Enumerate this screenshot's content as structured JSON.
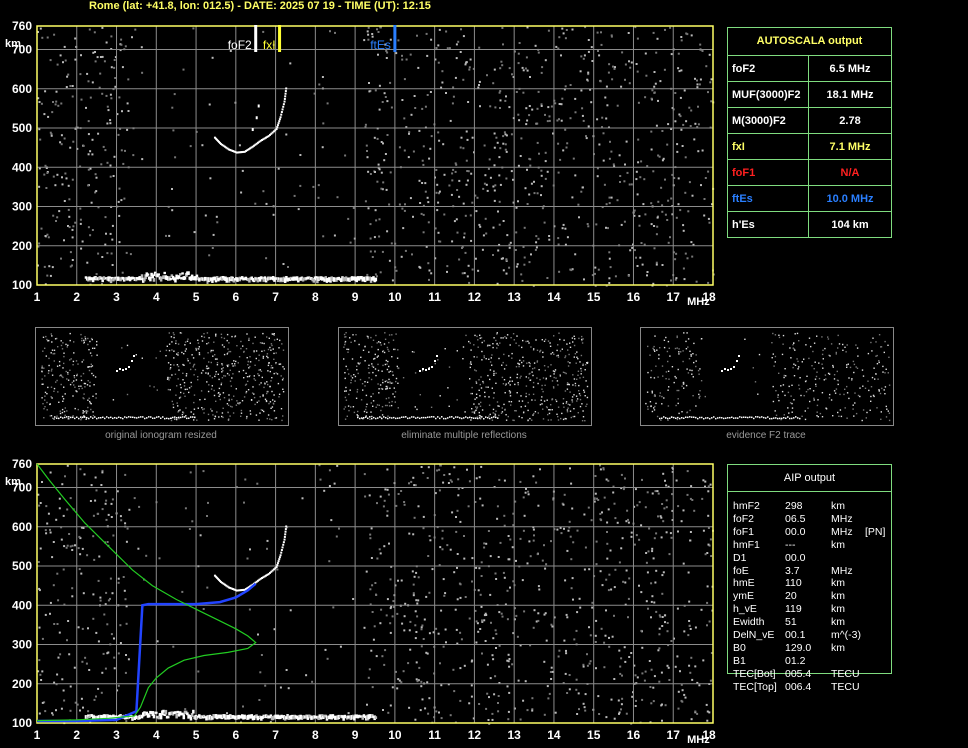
{
  "header": "Rome (lat: +41.8, lon: 012.5) - DATE: 2025 07 19 - TIME (UT): 12:15",
  "colors": {
    "grid": "#8c8c8c",
    "frame": "#ffff66",
    "panel_border": "#7fdc7f",
    "profile": "#22cc22",
    "trace_blue": "#2244ff",
    "foF2": "#ffffff",
    "fxI": "#ffff33",
    "ftEs": "#2a7fff",
    "label_red": "#ff2020",
    "label_yellow": "#ffff66",
    "label_blue": "#2a7fff"
  },
  "autoscala": {
    "title": "AUTOSCALA output",
    "rows": [
      {
        "label": "foF2",
        "value": "6.5 MHz",
        "color": "#ffffff"
      },
      {
        "label": "MUF(3000)F2",
        "value": "18.1 MHz",
        "color": "#ffffff"
      },
      {
        "label": "M(3000)F2",
        "value": "2.78",
        "color": "#ffffff"
      },
      {
        "label": "fxI",
        "value": "7.1 MHz",
        "color": "#ffff66"
      },
      {
        "label": "foF1",
        "value": "N/A",
        "color": "#ff2020"
      },
      {
        "label": "ftEs",
        "value": "10.0 MHz",
        "color": "#2a7fff"
      },
      {
        "label": "h'Es",
        "value": "104    km",
        "color": "#ffffff"
      }
    ]
  },
  "aip": {
    "title": "AIP output",
    "rows": [
      {
        "name": "hmF2",
        "value": "298",
        "unit": "km",
        "extra": ""
      },
      {
        "name": "foF2",
        "value": "06.5",
        "unit": "MHz",
        "extra": ""
      },
      {
        "name": "foF1",
        "value": "00.0",
        "unit": "MHz",
        "extra": "[PN]"
      },
      {
        "name": "hmF1",
        "value": "---",
        "unit": "km",
        "extra": ""
      },
      {
        "name": "D1",
        "value": "00.0",
        "unit": "",
        "extra": ""
      },
      {
        "name": "foE",
        "value": "3.7",
        "unit": "MHz",
        "extra": ""
      },
      {
        "name": "hmE",
        "value": "110",
        "unit": "km",
        "extra": ""
      },
      {
        "name": "ymE",
        "value": "20",
        "unit": "km",
        "extra": ""
      },
      {
        "name": "h_vE",
        "value": "119",
        "unit": "km",
        "extra": ""
      },
      {
        "name": "Ewidth",
        "value": "51",
        "unit": "km",
        "extra": ""
      },
      {
        "name": "DelN_vE",
        "value": "00.1",
        "unit": "m^(-3)",
        "extra": ""
      },
      {
        "name": "B0",
        "value": "129.0",
        "unit": "km",
        "extra": ""
      },
      {
        "name": "B1",
        "value": "01.2",
        "unit": "",
        "extra": ""
      },
      {
        "name": "TEC[Bot]",
        "value": "005.4",
        "unit": "TECU",
        "extra": ""
      },
      {
        "name": "TEC[Top]",
        "value": "006.4",
        "unit": "TECU",
        "extra": ""
      }
    ]
  },
  "thumbnails": {
    "captions": [
      "original ionogram resized",
      "eliminate multiple reflections",
      "evidence F2 trace"
    ]
  },
  "chart_data": [
    {
      "type": "scatter",
      "name": "ionogram-autoscala",
      "xlim": [
        1,
        18
      ],
      "ylim": [
        100,
        760
      ],
      "x_ticks": [
        1,
        2,
        3,
        4,
        5,
        6,
        7,
        8,
        9,
        10,
        11,
        12,
        13,
        14,
        15,
        16,
        17,
        18
      ],
      "y_ticks": [
        100,
        200,
        300,
        400,
        500,
        600,
        700,
        760
      ],
      "xunit": "MHz",
      "yunit": "km",
      "markers": [
        {
          "label": "foF2",
          "x": 6.5,
          "color": "#ffffff"
        },
        {
          "label": "fxI",
          "x": 7.1,
          "color": "#ffff33"
        },
        {
          "label": "ftEs",
          "x": 10.0,
          "color": "#2a7fff"
        }
      ],
      "f2_trace": [
        [
          5.45,
          478
        ],
        [
          5.6,
          462
        ],
        [
          5.8,
          448
        ],
        [
          6.0,
          440
        ],
        [
          6.2,
          442
        ],
        [
          6.4,
          455
        ],
        [
          6.6,
          470
        ],
        [
          6.8,
          482
        ],
        [
          7.0,
          500
        ],
        [
          7.1,
          530
        ],
        [
          7.2,
          570
        ],
        [
          7.25,
          610
        ]
      ],
      "f2_branch": [
        [
          6.4,
          500
        ],
        [
          6.5,
          530
        ],
        [
          6.55,
          560
        ]
      ],
      "es_trace_x": [
        2.2,
        9.5
      ],
      "es_height": 117
    },
    {
      "type": "line",
      "name": "ionogram-aip",
      "xlim": [
        1,
        18
      ],
      "ylim": [
        100,
        760
      ],
      "x_ticks": [
        1,
        2,
        3,
        4,
        5,
        6,
        7,
        8,
        9,
        10,
        11,
        12,
        13,
        14,
        15,
        16,
        17,
        18
      ],
      "y_ticks": [
        100,
        200,
        300,
        400,
        500,
        600,
        700,
        760
      ],
      "xunit": "MHz",
      "yunit": "km",
      "profile": [
        [
          1.0,
          760
        ],
        [
          1.3,
          720
        ],
        [
          1.7,
          670
        ],
        [
          2.2,
          610
        ],
        [
          2.8,
          550
        ],
        [
          3.4,
          490
        ],
        [
          3.9,
          450
        ],
        [
          4.5,
          415
        ],
        [
          5.1,
          385
        ],
        [
          5.6,
          360
        ],
        [
          6.0,
          340
        ],
        [
          6.3,
          322
        ],
        [
          6.5,
          305
        ],
        [
          6.3,
          290
        ],
        [
          5.8,
          280
        ],
        [
          5.2,
          272
        ],
        [
          4.7,
          260
        ],
        [
          4.3,
          240
        ],
        [
          4.0,
          215
        ],
        [
          3.8,
          190
        ],
        [
          3.7,
          165
        ],
        [
          3.6,
          140
        ],
        [
          3.45,
          118
        ],
        [
          2.8,
          112
        ],
        [
          2.0,
          108
        ],
        [
          1.0,
          106
        ]
      ],
      "virtual_height": [
        [
          1.0,
          105
        ],
        [
          2.0,
          105
        ],
        [
          3.0,
          108
        ],
        [
          3.5,
          130
        ],
        [
          3.65,
          400
        ],
        [
          3.8,
          403
        ],
        [
          4.3,
          403
        ],
        [
          5.0,
          403
        ],
        [
          5.6,
          408
        ],
        [
          6.0,
          420
        ],
        [
          6.3,
          438
        ],
        [
          6.5,
          455
        ]
      ],
      "f2_trace": [
        [
          5.45,
          478
        ],
        [
          5.6,
          462
        ],
        [
          5.8,
          448
        ],
        [
          6.0,
          440
        ],
        [
          6.2,
          442
        ],
        [
          6.4,
          455
        ],
        [
          6.6,
          470
        ],
        [
          6.8,
          482
        ],
        [
          7.0,
          500
        ],
        [
          7.1,
          530
        ],
        [
          7.2,
          570
        ],
        [
          7.25,
          610
        ]
      ],
      "es_trace_x": [
        2.2,
        9.5
      ],
      "es_height": 117
    }
  ]
}
